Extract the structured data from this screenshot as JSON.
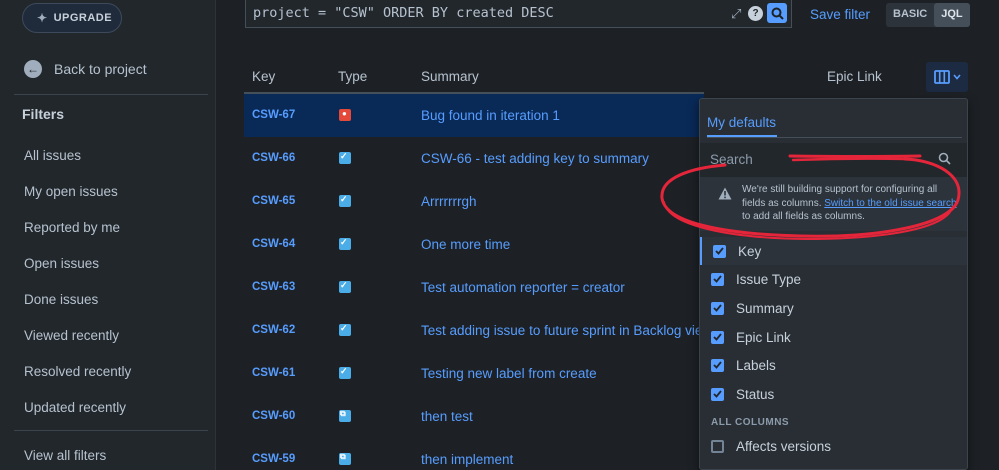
{
  "sidebar": {
    "upgrade_label": "UPGRADE",
    "back_label": "Back to project",
    "filters_heading": "Filters",
    "items": [
      {
        "label": "All issues"
      },
      {
        "label": "My open issues"
      },
      {
        "label": "Reported by me"
      },
      {
        "label": "Open issues"
      },
      {
        "label": "Done issues"
      },
      {
        "label": "Viewed recently"
      },
      {
        "label": "Resolved recently"
      },
      {
        "label": "Updated recently"
      }
    ],
    "view_all": "View all filters"
  },
  "query": {
    "text": "project = \"CSW\" ORDER BY created DESC",
    "save_filter": "Save filter",
    "mode_basic": "BASIC",
    "mode_jql": "JQL",
    "help": "?"
  },
  "table": {
    "headers": {
      "key": "Key",
      "type": "Type",
      "summary": "Summary",
      "epic": "Epic Link"
    },
    "rows": [
      {
        "key": "CSW-67",
        "type": "bug",
        "summary": "Bug found in iteration 1"
      },
      {
        "key": "CSW-66",
        "type": "story",
        "summary": "CSW-66 - test adding key to summary"
      },
      {
        "key": "CSW-65",
        "type": "story",
        "summary": "Arrrrrrrgh"
      },
      {
        "key": "CSW-64",
        "type": "story",
        "summary": "One more time"
      },
      {
        "key": "CSW-63",
        "type": "story",
        "summary": "Test automation reporter = creator"
      },
      {
        "key": "CSW-62",
        "type": "story",
        "summary": "Test adding issue to future sprint in Backlog view"
      },
      {
        "key": "CSW-61",
        "type": "story",
        "summary": "Testing new label from create"
      },
      {
        "key": "CSW-60",
        "type": "subtask",
        "summary": "then test"
      },
      {
        "key": "CSW-59",
        "type": "subtask",
        "summary": "then implement"
      }
    ]
  },
  "columns_panel": {
    "tab_label": "My defaults",
    "search_placeholder": "Search",
    "warning_text_1": "We're still building support for configuring all fields as columns. ",
    "warning_link": "Switch to the old issue search",
    "warning_text_2": " to add all fields as columns.",
    "selected": [
      {
        "label": "Key",
        "checked": true
      },
      {
        "label": "Issue Type",
        "checked": true
      },
      {
        "label": "Summary",
        "checked": true
      },
      {
        "label": "Epic Link",
        "checked": true
      },
      {
        "label": "Labels",
        "checked": true
      },
      {
        "label": "Status",
        "checked": true
      }
    ],
    "all_columns_heading": "ALL COLUMNS",
    "all_columns": [
      {
        "label": "Affects versions",
        "checked": false
      }
    ]
  },
  "colors": {
    "accent": "#579dff",
    "annotation": "#e5253a",
    "bug": "#e5493a",
    "story": "#4bade8"
  }
}
